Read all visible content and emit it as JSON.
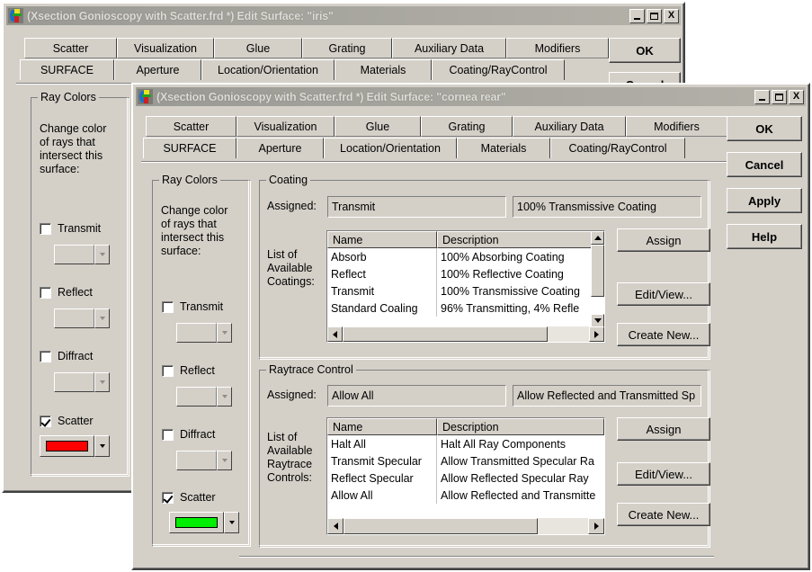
{
  "back_window": {
    "title": "(Xsection Gonioscopy with Scatter.frd *) Edit Surface: \"iris\"",
    "icon": "app-icon",
    "controls": {
      "minimize": "_",
      "maximize": "□",
      "close": "X"
    },
    "tabs_top": [
      "Scatter",
      "Visualization",
      "Glue",
      "Grating",
      "Auxiliary Data",
      "Modifiers"
    ],
    "tabs_bottom": [
      "SURFACE",
      "Aperture",
      "Location/Orientation",
      "Materials",
      "Coating/RayControl"
    ],
    "selected_tab": "Coating/RayControl",
    "buttons": [
      "OK",
      "Cancel"
    ],
    "ray_colors": {
      "group_label": "Ray Colors",
      "description": "Change color\nof rays that\nintersect this\nsurface:",
      "items": [
        {
          "label": "Transmit",
          "checked": false,
          "color": ""
        },
        {
          "label": "Reflect",
          "checked": false,
          "color": ""
        },
        {
          "label": "Diffract",
          "checked": false,
          "color": ""
        },
        {
          "label": "Scatter",
          "checked": true,
          "color": "#ff0000"
        }
      ]
    }
  },
  "front_window": {
    "title": "(Xsection Gonioscopy with Scatter.frd *) Edit Surface: \"cornea rear\"",
    "icon": "app-icon",
    "controls": {
      "minimize": "_",
      "maximize": "□",
      "close": "X"
    },
    "tabs_top": [
      "Scatter",
      "Visualization",
      "Glue",
      "Grating",
      "Auxiliary Data",
      "Modifiers"
    ],
    "tabs_bottom": [
      "SURFACE",
      "Aperture",
      "Location/Orientation",
      "Materials",
      "Coating/RayControl"
    ],
    "selected_tab": "Coating/RayControl",
    "buttons": [
      "OK",
      "Cancel",
      "Apply",
      "Help"
    ],
    "ray_colors": {
      "group_label": "Ray Colors",
      "description": "Change color\nof rays that\nintersect this\nsurface:",
      "items": [
        {
          "label": "Transmit",
          "checked": false,
          "color": ""
        },
        {
          "label": "Reflect",
          "checked": false,
          "color": ""
        },
        {
          "label": "Diffract",
          "checked": false,
          "color": ""
        },
        {
          "label": "Scatter",
          "checked": true,
          "color": "#00ee00"
        }
      ]
    },
    "coating": {
      "group_label": "Coating",
      "assigned_label": "Assigned:",
      "assigned_name": "Transmit",
      "assigned_description": "100% Transmissive Coating",
      "list_label": "List of\nAvailable\nCoatings:",
      "columns": [
        "Name",
        "Description"
      ],
      "rows": [
        {
          "name": "Absorb",
          "description": "100% Absorbing Coating"
        },
        {
          "name": "Reflect",
          "description": "100% Reflective Coating"
        },
        {
          "name": "Transmit",
          "description": "100% Transmissive Coating"
        },
        {
          "name": "Standard Coaling",
          "description": "96% Transmitting, 4% Refle"
        }
      ],
      "buttons": [
        "Assign",
        "Edit/View...",
        "Create New..."
      ]
    },
    "raytrace": {
      "group_label": "Raytrace Control",
      "assigned_label": "Assigned:",
      "assigned_name": "Allow All",
      "assigned_description": "Allow Reflected and Transmitted Sp",
      "list_label": "List of\nAvailable\nRaytrace\nControls:",
      "columns": [
        "Name",
        "Description"
      ],
      "rows": [
        {
          "name": "Halt All",
          "description": "Halt All Ray Components"
        },
        {
          "name": "Transmit Specular",
          "description": "Allow Transmitted Specular Ra"
        },
        {
          "name": "Reflect Specular",
          "description": "Allow Reflected Specular Ray"
        },
        {
          "name": "Allow All",
          "description": "Allow Reflected and Transmitte"
        }
      ],
      "buttons": [
        "Assign",
        "Edit/View...",
        "Create New..."
      ]
    }
  },
  "colors": {
    "face": "#d4d0c8",
    "title_inactive": "#9a9a94",
    "scatter_back": "#ff0000",
    "scatter_front": "#00ee00"
  }
}
